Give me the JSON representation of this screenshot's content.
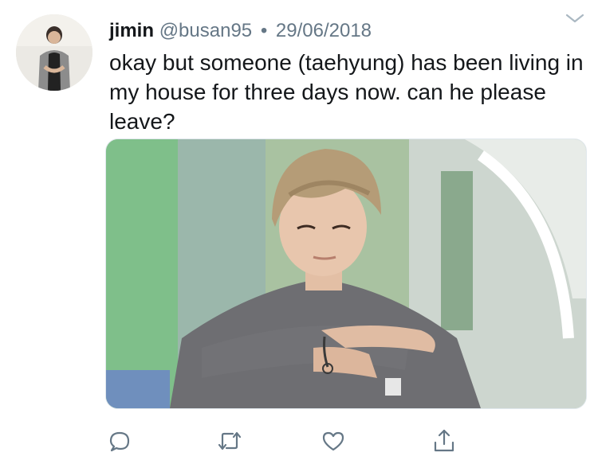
{
  "tweet": {
    "author_name": "jimin",
    "handle": "@busan95",
    "separator": "•",
    "date": "29/06/2018",
    "text": "okay but someone (taehyung) has been living in my house for three days now. can he please leave?"
  },
  "icons": {
    "menu": "chevron-down-icon",
    "reply": "reply-icon",
    "retweet": "retweet-icon",
    "like": "heart-icon",
    "share": "share-icon"
  },
  "colors": {
    "text": "#14171a",
    "secondary": "#657786",
    "icon": "#657786"
  }
}
